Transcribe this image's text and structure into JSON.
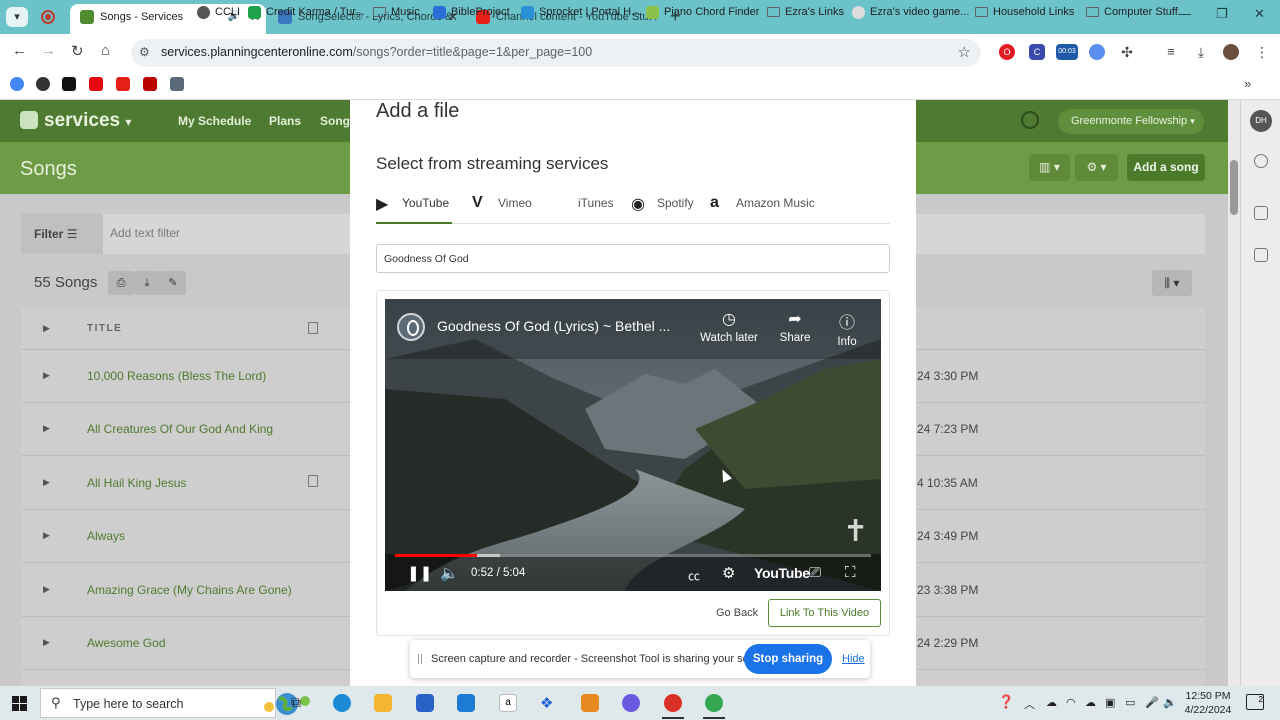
{
  "browser": {
    "tabs": [
      {
        "title": "Songs - Services",
        "active": true
      },
      {
        "title": "SongSelect® - Lyrics, Chords &",
        "active": false
      },
      {
        "title": "Channel content - YouTube Stu",
        "active": false
      }
    ],
    "url_host": "services.planningcenteronline.com",
    "url_path": "/songs?order=title&page=1&per_page=100",
    "extension_badge": "00:03",
    "profile_initial": "DH",
    "bookmarks": [
      "CCLI",
      "Credit Karma / Tur...",
      "Music",
      "BibleProject",
      "Sprocket | Portal H...",
      "Piano Chord Finder",
      "Ezra's Links",
      "Ezra's video game...",
      "Household Links",
      "Computer Stuff"
    ]
  },
  "app": {
    "logo_text": "services",
    "nav": [
      "My Schedule",
      "Plans",
      "Songs"
    ],
    "org_name": "Greenmonte Fellowship",
    "page_title": "Songs",
    "add_song_label": "Add a song",
    "filter_label": "Filter",
    "filter_placeholder": "Add text filter",
    "songs_count": "55 Songs",
    "column_title": "TITLE",
    "rows": [
      {
        "title": "10,000 Reasons (Bless The Lord)",
        "date": "24 3:30 PM",
        "has_file": false
      },
      {
        "title": "All Creatures Of Our God And King",
        "date": "24 7:23 PM",
        "has_file": false
      },
      {
        "title": "All Hail King Jesus",
        "date": "4 10:35 AM",
        "has_file": true
      },
      {
        "title": "Always",
        "date": "24 3:49 PM",
        "has_file": false
      },
      {
        "title": "Amazing Grace (My Chains Are Gone)",
        "date": "23 3:38 PM",
        "has_file": false
      },
      {
        "title": "Awesome God",
        "date": "24 2:29 PM",
        "has_file": false
      }
    ]
  },
  "modal": {
    "title": "Add a file",
    "subtitle": "Select from streaming services",
    "services": [
      "YouTube",
      "Vimeo",
      "iTunes",
      "Spotify",
      "Amazon Music"
    ],
    "active_service": "YouTube",
    "search_value": "Goodness Of God",
    "video": {
      "title": "Goodness Of God (Lyrics) ~ Bethel ...",
      "watch_later": "Watch later",
      "share": "Share",
      "info": "Info",
      "time": "0:52 / 5:04",
      "progress": 0.172,
      "logo_text": "YouTube"
    },
    "go_back_label": "Go Back",
    "link_label": "Link To This Video"
  },
  "share_banner": {
    "text": "Screen capture and recorder - Screenshot Tool is sharing your screen.",
    "stop_label": "Stop sharing",
    "hide_label": "Hide"
  },
  "taskbar": {
    "search_placeholder": "Type here to search",
    "time": "12:50 PM",
    "date": "4/22/2024",
    "notifications": "2"
  }
}
